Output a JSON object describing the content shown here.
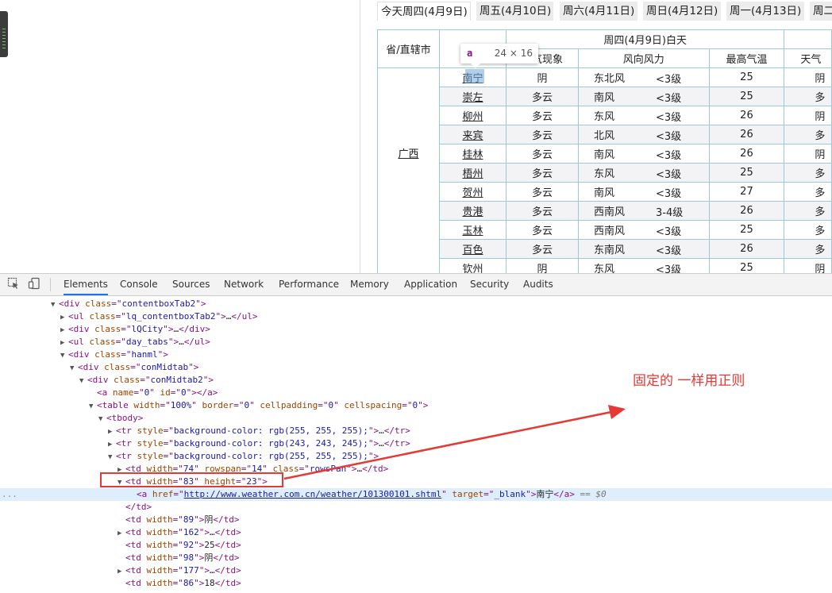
{
  "tabs": [
    "今天周四(4月9日)",
    "周五(4月10日)",
    "周六(4月11日)",
    "周日(4月12日)",
    "周一(4月13日)",
    "周二"
  ],
  "table": {
    "province_header": "省/直辖市",
    "day_header": "周四(4月9日)白天",
    "col_weather": "天气现象",
    "col_wind": "风向风力",
    "col_max": "最高气温",
    "col_next": "天气",
    "province": "广西",
    "rows": [
      {
        "city": "南宁",
        "weather": "阴",
        "wind_dir": "东北风",
        "wind_lv": "<3级",
        "max": "25",
        "next": "阴"
      },
      {
        "city": "崇左",
        "weather": "多云",
        "wind_dir": "南风",
        "wind_lv": "<3级",
        "max": "25",
        "next": "多"
      },
      {
        "city": "柳州",
        "weather": "多云",
        "wind_dir": "东风",
        "wind_lv": "<3级",
        "max": "26",
        "next": "阴"
      },
      {
        "city": "来宾",
        "weather": "多云",
        "wind_dir": "北风",
        "wind_lv": "<3级",
        "max": "26",
        "next": "多"
      },
      {
        "city": "桂林",
        "weather": "多云",
        "wind_dir": "南风",
        "wind_lv": "<3级",
        "max": "26",
        "next": "阴"
      },
      {
        "city": "梧州",
        "weather": "多云",
        "wind_dir": "东风",
        "wind_lv": "<3级",
        "max": "25",
        "next": "多"
      },
      {
        "city": "贺州",
        "weather": "多云",
        "wind_dir": "南风",
        "wind_lv": "<3级",
        "max": "27",
        "next": "多"
      },
      {
        "city": "贵港",
        "weather": "多云",
        "wind_dir": "西南风",
        "wind_lv": "3-4级",
        "max": "26",
        "next": "多"
      },
      {
        "city": "玉林",
        "weather": "多云",
        "wind_dir": "西南风",
        "wind_lv": "<3级",
        "max": "25",
        "next": "多"
      },
      {
        "city": "百色",
        "weather": "多云",
        "wind_dir": "东南风",
        "wind_lv": "<3级",
        "max": "26",
        "next": "多"
      },
      {
        "city": "钦州",
        "weather": "阴",
        "wind_dir": "东风",
        "wind_lv": "<3级",
        "max": "25",
        "next": "阴"
      }
    ]
  },
  "tooltip": {
    "tag": "a",
    "size": "24 × 16"
  },
  "devtools": {
    "tabs": [
      "Elements",
      "Console",
      "Sources",
      "Network",
      "Performance",
      "Memory",
      "Application",
      "Security",
      "Audits"
    ],
    "active_tab": "Elements",
    "dom_lines": [
      {
        "tri": "▼",
        "parts": [
          [
            "t",
            "<div "
          ],
          [
            "n",
            "class"
          ],
          [
            "t",
            "=\""
          ],
          [
            "v",
            "contentboxTab2"
          ],
          [
            "t",
            "\">"
          ]
        ]
      },
      {
        "tri": "▶",
        "parts": [
          [
            "t",
            "<ul "
          ],
          [
            "n",
            "class"
          ],
          [
            "t",
            "=\""
          ],
          [
            "v",
            "lq_contentboxTab2"
          ],
          [
            "t",
            "\">"
          ],
          [
            "x",
            "…"
          ],
          [
            "t",
            "</ul>"
          ]
        ]
      },
      {
        "tri": "▶",
        "parts": [
          [
            "t",
            "<div "
          ],
          [
            "n",
            "class"
          ],
          [
            "t",
            "=\""
          ],
          [
            "v",
            "lQCity"
          ],
          [
            "t",
            "\">"
          ],
          [
            "x",
            "…"
          ],
          [
            "t",
            "</div>"
          ]
        ]
      },
      {
        "tri": "▶",
        "parts": [
          [
            "t",
            "<ul "
          ],
          [
            "n",
            "class"
          ],
          [
            "t",
            "=\""
          ],
          [
            "v",
            "day_tabs"
          ],
          [
            "t",
            "\">"
          ],
          [
            "x",
            "…"
          ],
          [
            "t",
            "</ul>"
          ]
        ]
      },
      {
        "tri": "▼",
        "parts": [
          [
            "t",
            "<div "
          ],
          [
            "n",
            "class"
          ],
          [
            "t",
            "=\""
          ],
          [
            "v",
            "hanml"
          ],
          [
            "t",
            "\">"
          ]
        ]
      },
      {
        "tri": "▼",
        "parts": [
          [
            "t",
            "<div "
          ],
          [
            "n",
            "class"
          ],
          [
            "t",
            "=\""
          ],
          [
            "v",
            "conMidtab"
          ],
          [
            "t",
            "\">"
          ]
        ]
      },
      {
        "tri": "▼",
        "parts": [
          [
            "t",
            "<div "
          ],
          [
            "n",
            "class"
          ],
          [
            "t",
            "=\""
          ],
          [
            "v",
            "conMidtab2"
          ],
          [
            "t",
            "\">"
          ]
        ]
      },
      {
        "tri": "",
        "parts": [
          [
            "t",
            "<a "
          ],
          [
            "n",
            "name"
          ],
          [
            "t",
            "=\""
          ],
          [
            "v",
            "0"
          ],
          [
            "t",
            "\" "
          ],
          [
            "n",
            "id"
          ],
          [
            "t",
            "=\""
          ],
          [
            "v",
            "0"
          ],
          [
            "t",
            "\"></a>"
          ]
        ]
      },
      {
        "tri": "▼",
        "parts": [
          [
            "t",
            "<table "
          ],
          [
            "n",
            "width"
          ],
          [
            "t",
            "=\""
          ],
          [
            "v",
            "100%"
          ],
          [
            "t",
            "\" "
          ],
          [
            "n",
            "border"
          ],
          [
            "t",
            "=\""
          ],
          [
            "v",
            "0"
          ],
          [
            "t",
            "\" "
          ],
          [
            "n",
            "cellpadding"
          ],
          [
            "t",
            "=\""
          ],
          [
            "v",
            "0"
          ],
          [
            "t",
            "\" "
          ],
          [
            "n",
            "cellspacing"
          ],
          [
            "t",
            "=\""
          ],
          [
            "v",
            "0"
          ],
          [
            "t",
            "\">"
          ]
        ]
      },
      {
        "tri": "▼",
        "parts": [
          [
            "t",
            "<tbody>"
          ]
        ]
      },
      {
        "tri": "▶",
        "parts": [
          [
            "t",
            "<tr "
          ],
          [
            "n",
            "style"
          ],
          [
            "t",
            "=\""
          ],
          [
            "v",
            "background-color: rgb(255, 255, 255);"
          ],
          [
            "t",
            "\">"
          ],
          [
            "x",
            "…"
          ],
          [
            "t",
            "</tr>"
          ]
        ]
      },
      {
        "tri": "▶",
        "parts": [
          [
            "t",
            "<tr "
          ],
          [
            "n",
            "style"
          ],
          [
            "t",
            "=\""
          ],
          [
            "v",
            "background-color: rgb(243, 243, 245);"
          ],
          [
            "t",
            "\">"
          ],
          [
            "x",
            "…"
          ],
          [
            "t",
            "</tr>"
          ]
        ]
      },
      {
        "tri": "▼",
        "parts": [
          [
            "t",
            "<tr "
          ],
          [
            "n",
            "style"
          ],
          [
            "t",
            "=\""
          ],
          [
            "v",
            "background-color: rgb(255, 255, 255);"
          ],
          [
            "t",
            "\">"
          ]
        ]
      },
      {
        "tri": "▶",
        "parts": [
          [
            "t",
            "<td "
          ],
          [
            "n",
            "width"
          ],
          [
            "t",
            "=\""
          ],
          [
            "v",
            "74"
          ],
          [
            "t",
            "\" "
          ],
          [
            "n",
            "rowspan"
          ],
          [
            "t",
            "=\""
          ],
          [
            "v",
            "14"
          ],
          [
            "t",
            "\" "
          ],
          [
            "n",
            "class"
          ],
          [
            "t",
            "=\""
          ],
          [
            "v",
            "rowsPan"
          ],
          [
            "t",
            "\">"
          ],
          [
            "x",
            "…"
          ],
          [
            "t",
            "</td>"
          ]
        ]
      },
      {
        "tri": "▼",
        "parts": [
          [
            "t",
            "<td "
          ],
          [
            "n",
            "width"
          ],
          [
            "t",
            "=\""
          ],
          [
            "v",
            "83"
          ],
          [
            "t",
            "\" "
          ],
          [
            "n",
            "height"
          ],
          [
            "t",
            "=\""
          ],
          [
            "v",
            "23"
          ],
          [
            "t",
            "\">"
          ]
        ]
      },
      {
        "tri": "",
        "parts": [
          [
            "t",
            "<a "
          ],
          [
            "n",
            "href"
          ],
          [
            "t",
            "=\""
          ],
          [
            "l",
            "http://www.weather.com.cn/weather/101300101.shtml"
          ],
          [
            "t",
            "\" "
          ],
          [
            "n",
            "target"
          ],
          [
            "t",
            "=\""
          ],
          [
            "v",
            "_blank"
          ],
          [
            "t",
            "\">"
          ],
          [
            "x",
            "南宁"
          ],
          [
            "t",
            "</a>"
          ],
          [
            "e",
            " == $0"
          ]
        ]
      },
      {
        "tri": "",
        "parts": [
          [
            "t",
            "</td>"
          ]
        ]
      },
      {
        "tri": "",
        "parts": [
          [
            "t",
            "<td "
          ],
          [
            "n",
            "width"
          ],
          [
            "t",
            "=\""
          ],
          [
            "v",
            "89"
          ],
          [
            "t",
            "\">"
          ],
          [
            "x",
            "阴"
          ],
          [
            "t",
            "</td>"
          ]
        ]
      },
      {
        "tri": "▶",
        "parts": [
          [
            "t",
            "<td "
          ],
          [
            "n",
            "width"
          ],
          [
            "t",
            "=\""
          ],
          [
            "v",
            "162"
          ],
          [
            "t",
            "\">"
          ],
          [
            "x",
            "…"
          ],
          [
            "t",
            "</td>"
          ]
        ]
      },
      {
        "tri": "",
        "parts": [
          [
            "t",
            "<td "
          ],
          [
            "n",
            "width"
          ],
          [
            "t",
            "=\""
          ],
          [
            "v",
            "92"
          ],
          [
            "t",
            "\">"
          ],
          [
            "x",
            "25"
          ],
          [
            "t",
            "</td>"
          ]
        ]
      },
      {
        "tri": "",
        "parts": [
          [
            "t",
            "<td "
          ],
          [
            "n",
            "width"
          ],
          [
            "t",
            "=\""
          ],
          [
            "v",
            "98"
          ],
          [
            "t",
            "\">"
          ],
          [
            "x",
            "阴"
          ],
          [
            "t",
            "</td>"
          ]
        ]
      },
      {
        "tri": "▶",
        "parts": [
          [
            "t",
            "<td "
          ],
          [
            "n",
            "width"
          ],
          [
            "t",
            "=\""
          ],
          [
            "v",
            "177"
          ],
          [
            "t",
            "\">"
          ],
          [
            "x",
            "…"
          ],
          [
            "t",
            "</td>"
          ]
        ]
      },
      {
        "tri": "",
        "parts": [
          [
            "t",
            "<td "
          ],
          [
            "n",
            "width"
          ],
          [
            "t",
            "=\""
          ],
          [
            "v",
            "86"
          ],
          [
            "t",
            "\">"
          ],
          [
            "x",
            "18"
          ],
          [
            "t",
            "</td>"
          ]
        ]
      }
    ],
    "selected_dots": "..."
  },
  "annotation": "固定的 一样用正则",
  "colors": {
    "annotation": "#e53935",
    "table_border": "#9bc8dc",
    "highlight": "#6fa8dc"
  }
}
